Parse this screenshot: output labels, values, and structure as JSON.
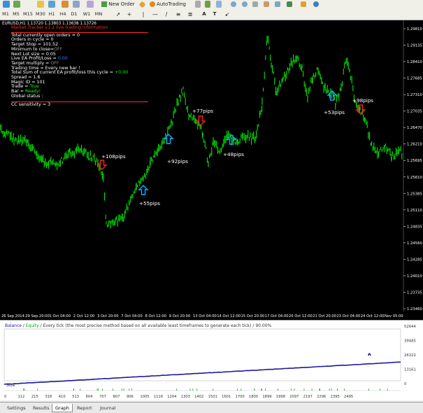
{
  "toolbar": {
    "timeframes": [
      "M1",
      "M5",
      "M15",
      "M30",
      "H1",
      "H4",
      "D1",
      "W1",
      "MN"
    ],
    "new_order_label": "New Order",
    "autotrading_label": "AutoTrading"
  },
  "chart": {
    "symbol_header": "EURUSD,H1  1.13720 1.13803 1.13638 1.13726",
    "info": {
      "title": "Market Tracker v1.2 live trading information",
      "open_orders": "Total currently open orders = 0",
      "orders_in_cycle": "Orders in cycle = 0",
      "target_stop": "Target Stop = 101.52",
      "min_close_label": "Minimum to close=",
      "min_close_value": "OFF",
      "next_lot": "Next Lot size = 0.05",
      "live_pl_label": "Live EA Profit/Loss = ",
      "live_pl_value": "0.00",
      "target_mult_label": "Target multiply = ",
      "target_mult_value": "OFF",
      "trading_time": "Trading time = Every new bar !",
      "total_sum_label": "Total Sum of current EA profit/loss this cycle = ",
      "total_sum_value": "+0.00",
      "spread": "Spread = 1.6",
      "magic": "Magic ID = 101",
      "trade_label": "Trade = ",
      "trade_value": "True",
      "bar_label": "Bar = ",
      "bar_value": "Ready!",
      "global_status": "Global status :",
      "cc": "CC sensitivity = 3"
    },
    "trade_labels": {
      "l108": "+108pips",
      "l55": "+55pips",
      "l92": "+92pips",
      "l77": "+77pips",
      "l48": "+48pips",
      "l53": "+53pips",
      "l98": "+98pips"
    },
    "price_ticks": [
      "1.29810",
      "1.29135",
      "1.28410",
      "1.27685",
      "1.27310",
      "1.27035",
      "1.26470",
      "1.26210",
      "1.25695",
      "1.25610",
      "1.25385",
      "1.25110",
      "1.24835",
      "1.24560",
      "1.24285",
      "1.24010",
      "1.23735",
      "1.23460"
    ],
    "time_ticks": [
      "26 Sep 2014",
      "29 Sep 20:00",
      "1 Oct 04:00",
      "2 Oct 12:00",
      "3 Oct 20:00",
      "7 Oct 04:00",
      "8 Oct 12:00",
      "9 Oct 20:00",
      "13 Oct 04:00",
      "14 Oct 12:00",
      "15 Oct 20:00",
      "17 Oct 04:00",
      "20 Oct 12:00",
      "21 Oct 20:00",
      "23 Oct 04:00",
      "24 Oct 12:00",
      "Nov 05:00"
    ]
  },
  "balance": {
    "title_balance": "Balance",
    "title_sep": " / ",
    "title_equity": "Equity",
    "title_rest": " / Every tick (the most precise method based on all available least timeframes to generate each tick) / 90.00%",
    "y_ticks": [
      "52644",
      "39485",
      "26322",
      "13161",
      "0"
    ],
    "size_label": "Size",
    "x_ticks": [
      "0",
      "112",
      "215",
      "318",
      "410",
      "513",
      "604",
      "707",
      "807",
      "906",
      "1005",
      "1116",
      "1204",
      "1303",
      "1402",
      "1501",
      "1601",
      "1700",
      "1800",
      "1899",
      "1998",
      "2097",
      "2197",
      "2296",
      "2395",
      "2495"
    ],
    "color": "#1a1a9e"
  },
  "tabs": [
    "Settings",
    "Results",
    "Graph",
    "Report",
    "Journal"
  ],
  "active_tab": "Graph",
  "colors": {
    "candle": "#00ff00",
    "arrow_up": "#0ab4ff",
    "arrow_down": "#ff2020"
  }
}
